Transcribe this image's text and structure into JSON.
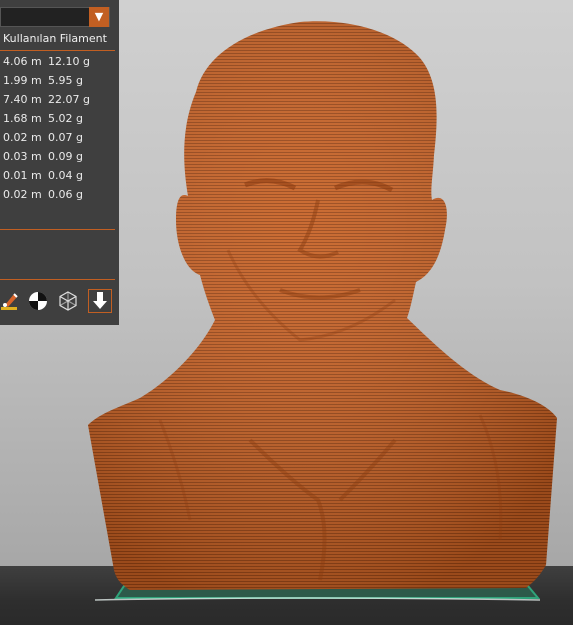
{
  "sidebar": {
    "dropdown": {
      "value": "",
      "arrow_icon": "chevron-down-icon"
    },
    "header": "Kullanılan Filament",
    "rows": [
      {
        "length": "4.06 m",
        "weight": "12.10 g"
      },
      {
        "length": "1.99 m",
        "weight": "5.95 g"
      },
      {
        "length": "7.40 m",
        "weight": "22.07 g"
      },
      {
        "length": "1.68 m",
        "weight": "5.02 g"
      },
      {
        "length": "0.02 m",
        "weight": "0.07 g"
      },
      {
        "length": "0.03 m",
        "weight": "0.09 g"
      },
      {
        "length": "0.01 m",
        "weight": "0.04 g"
      },
      {
        "length": "0.02 m",
        "weight": "0.06 g"
      }
    ],
    "tools": [
      {
        "name": "paint-brush-icon"
      },
      {
        "name": "seam-circle-icon"
      },
      {
        "name": "wireframe-cube-icon"
      },
      {
        "name": "export-icon"
      }
    ]
  },
  "colors": {
    "model": "#c55f23",
    "accent": "#c25f22",
    "panel": "#3f3f3f",
    "bed": "#2e2e2e",
    "plate_outline": "#2b8f6a"
  }
}
